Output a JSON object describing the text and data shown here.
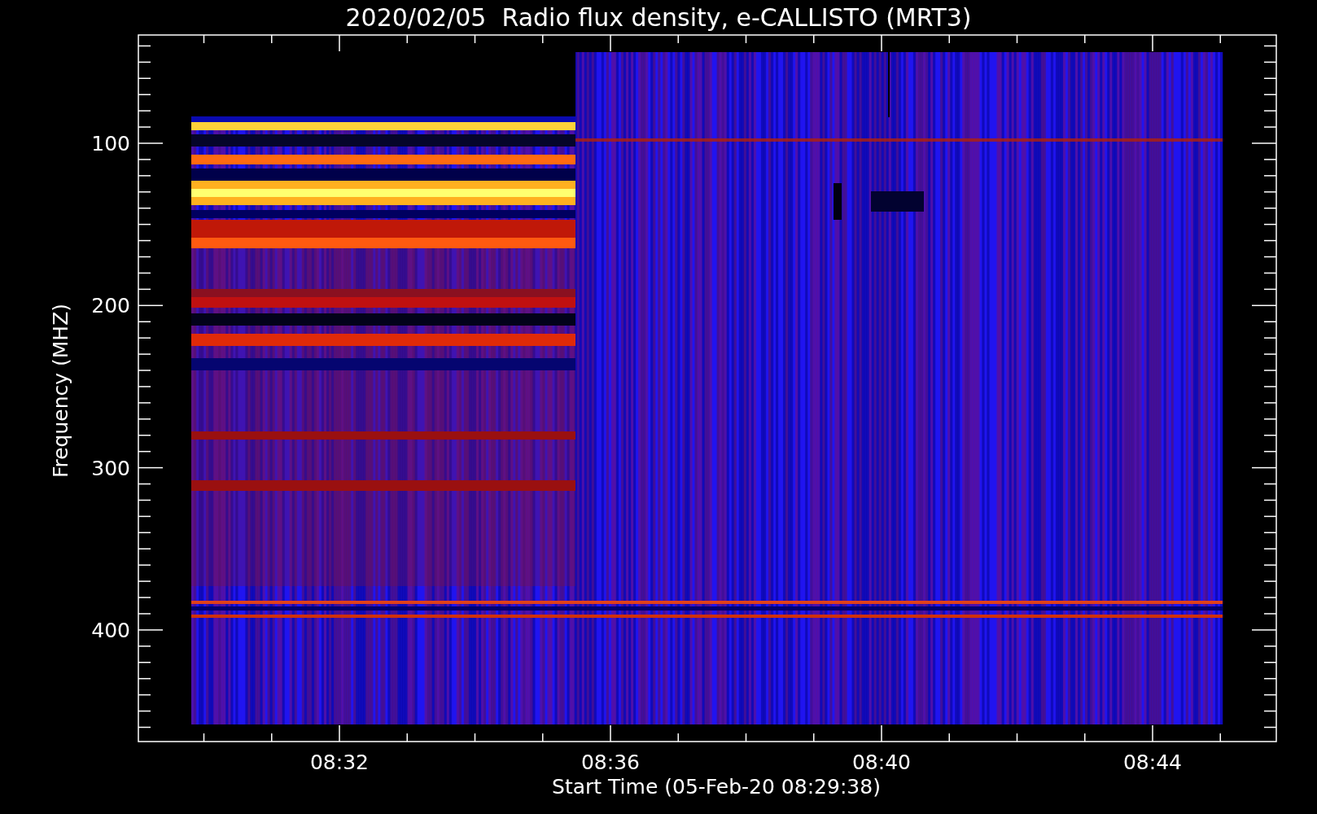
{
  "title": "2020/02/05  Radio flux density, e-CALLISTO (MRT3)",
  "plot": {
    "ylabel": "Frequency (MHZ)",
    "xlabel": "Start Time (05-Feb-20 08:29:38)",
    "xticks": [
      "08:32",
      "08:36",
      "08:40",
      "08:44"
    ],
    "yticks": [
      "100",
      "200",
      "300",
      "400"
    ]
  }
}
